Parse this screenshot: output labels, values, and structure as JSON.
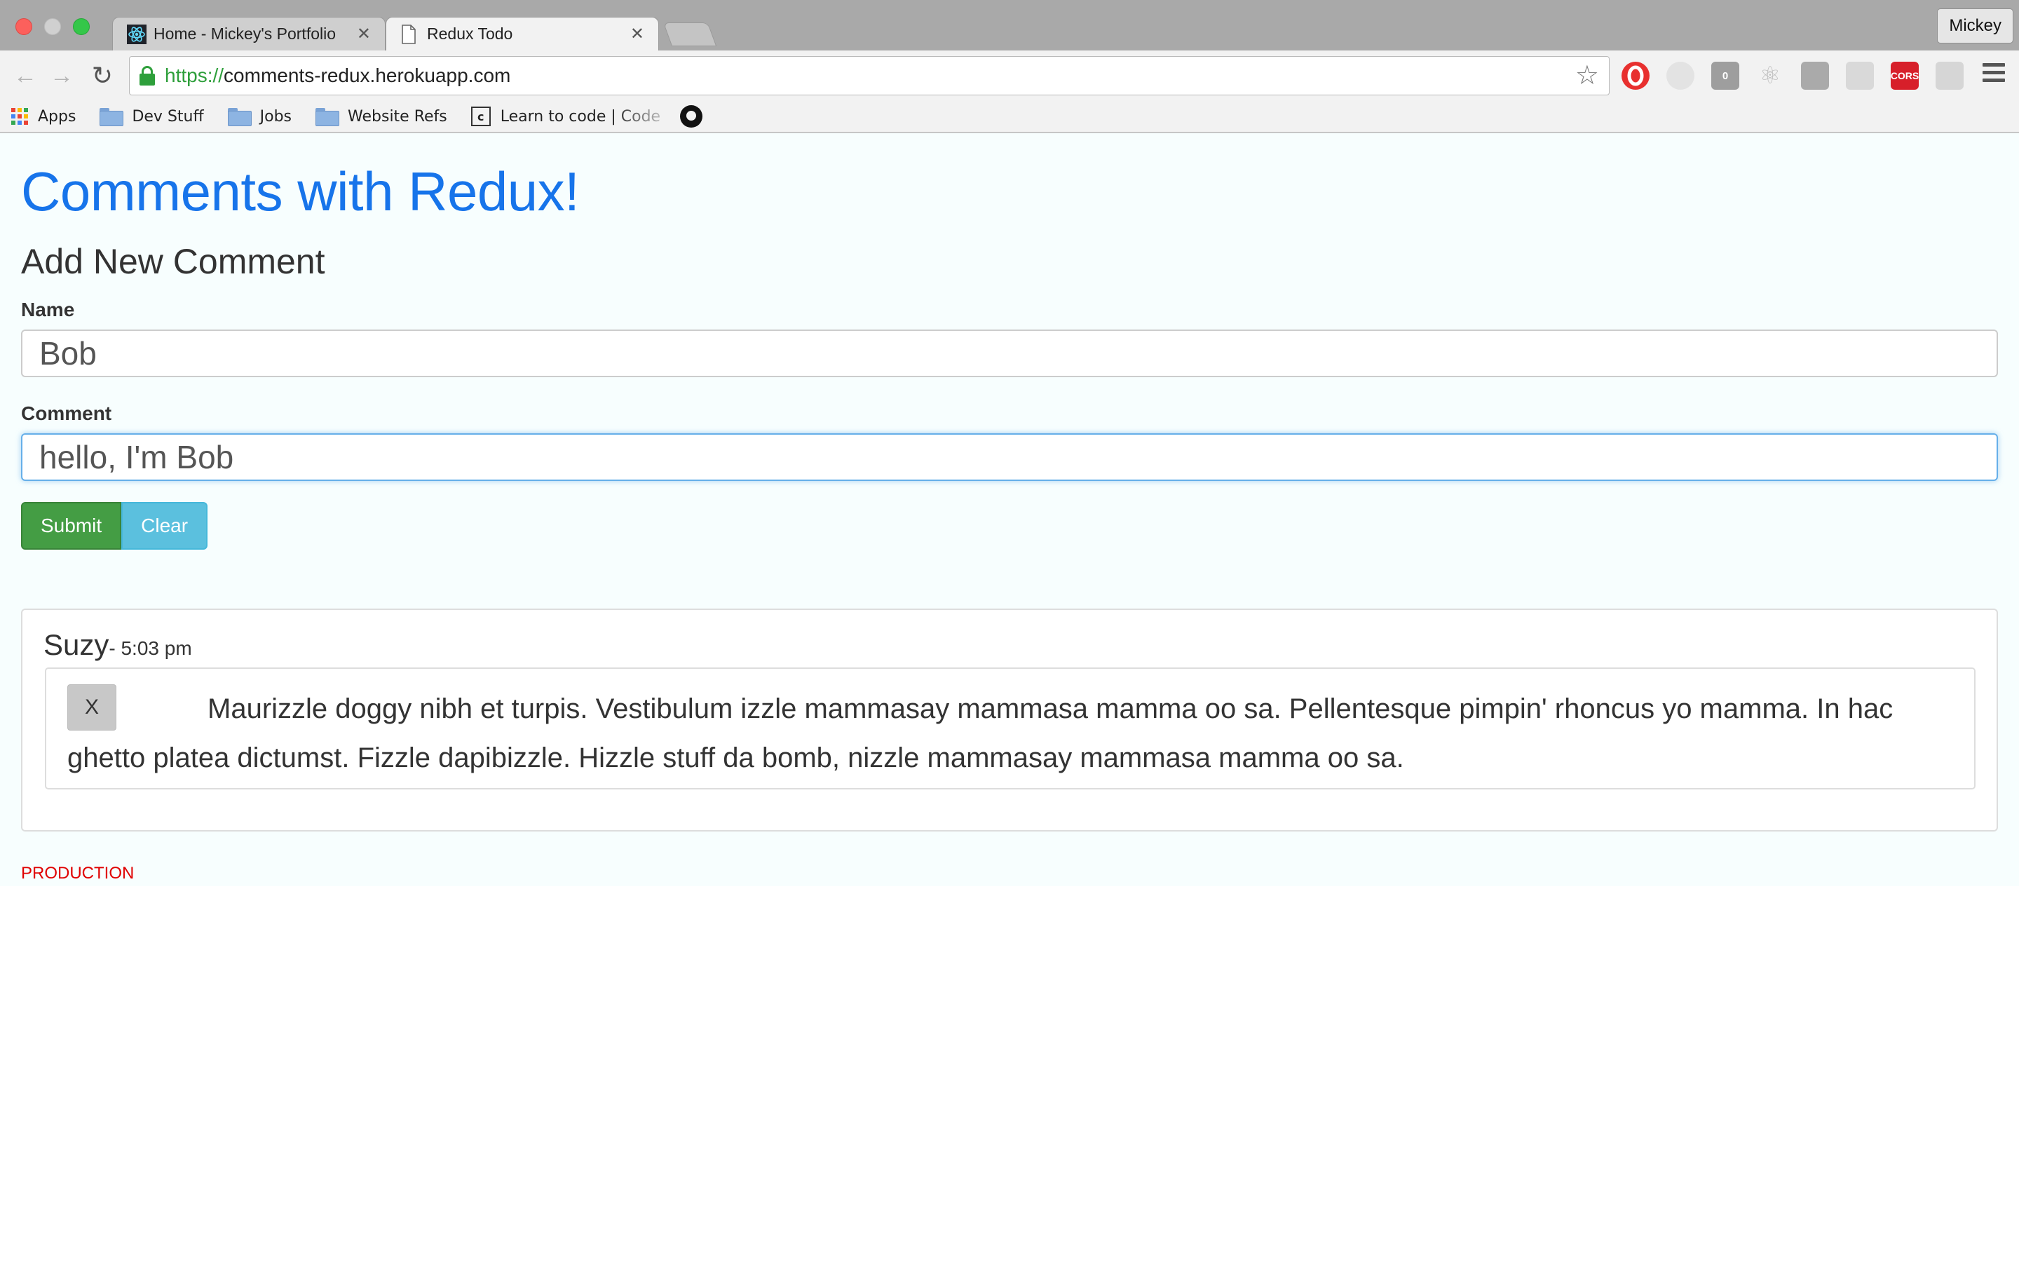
{
  "browser": {
    "tabs": [
      {
        "title": "Home - Mickey's Portfolio",
        "active": false,
        "icon": "react-icon"
      },
      {
        "title": "Redux Todo",
        "active": true,
        "icon": "page-icon"
      }
    ],
    "profile_name": "Mickey",
    "url": {
      "scheme": "https://",
      "host": "comments-redux.herokuapp.com"
    },
    "extensions": [
      {
        "name": "opera-icon",
        "color": "#e8302f",
        "text": ""
      },
      {
        "name": "ghost-extension-icon",
        "color": "#e3e3e3",
        "text": ""
      },
      {
        "name": "counter-extension-icon",
        "color": "#9e9e9e",
        "text": "0"
      },
      {
        "name": "react-devtools-icon",
        "color": "#bdbdbd",
        "text": "⚛"
      },
      {
        "name": "redux-extension-icon",
        "color": "#aaaaaa",
        "text": ""
      },
      {
        "name": "feather-extension-icon",
        "color": "#d9d9d9",
        "text": ""
      },
      {
        "name": "cors-extension-icon",
        "color": "#d71f2a",
        "text": "CORS"
      },
      {
        "name": "grey-extension-icon",
        "color": "#d6d6d6",
        "text": ""
      }
    ],
    "bookmarks": [
      {
        "label": "Apps",
        "type": "apps"
      },
      {
        "label": "Dev Stuff",
        "type": "folder"
      },
      {
        "label": "Jobs",
        "type": "folder"
      },
      {
        "label": "Website Refs",
        "type": "folder"
      },
      {
        "label": "Learn to code | Code",
        "type": "codecademy"
      },
      {
        "label": "",
        "type": "github"
      }
    ]
  },
  "page": {
    "title": "Comments with Redux!",
    "form": {
      "heading": "Add New Comment",
      "name_label": "Name",
      "name_value": "Bob",
      "comment_label": "Comment",
      "comment_value": "hello, I'm Bob",
      "submit_label": "Submit",
      "clear_label": "Clear"
    },
    "comments": [
      {
        "author": "Suzy",
        "time": "- 5:03 pm",
        "delete_label": "X",
        "text": "Maurizzle doggy nibh et turpis. Vestibulum izzle mammasay mammasa mamma oo sa. Pellentesque pimpin' rhoncus yo mamma. In hac ghetto platea dictumst. Fizzle dapibizzle. Hizzle stuff da bomb, nizzle mammasay mammasa mamma oo sa."
      }
    ],
    "environment": "PRODUCTION"
  },
  "colors": {
    "title": "#1774ea",
    "submit": "#449d44",
    "clear": "#5bc0de",
    "environment": "#e00000",
    "app_background": "#f7fefe"
  }
}
